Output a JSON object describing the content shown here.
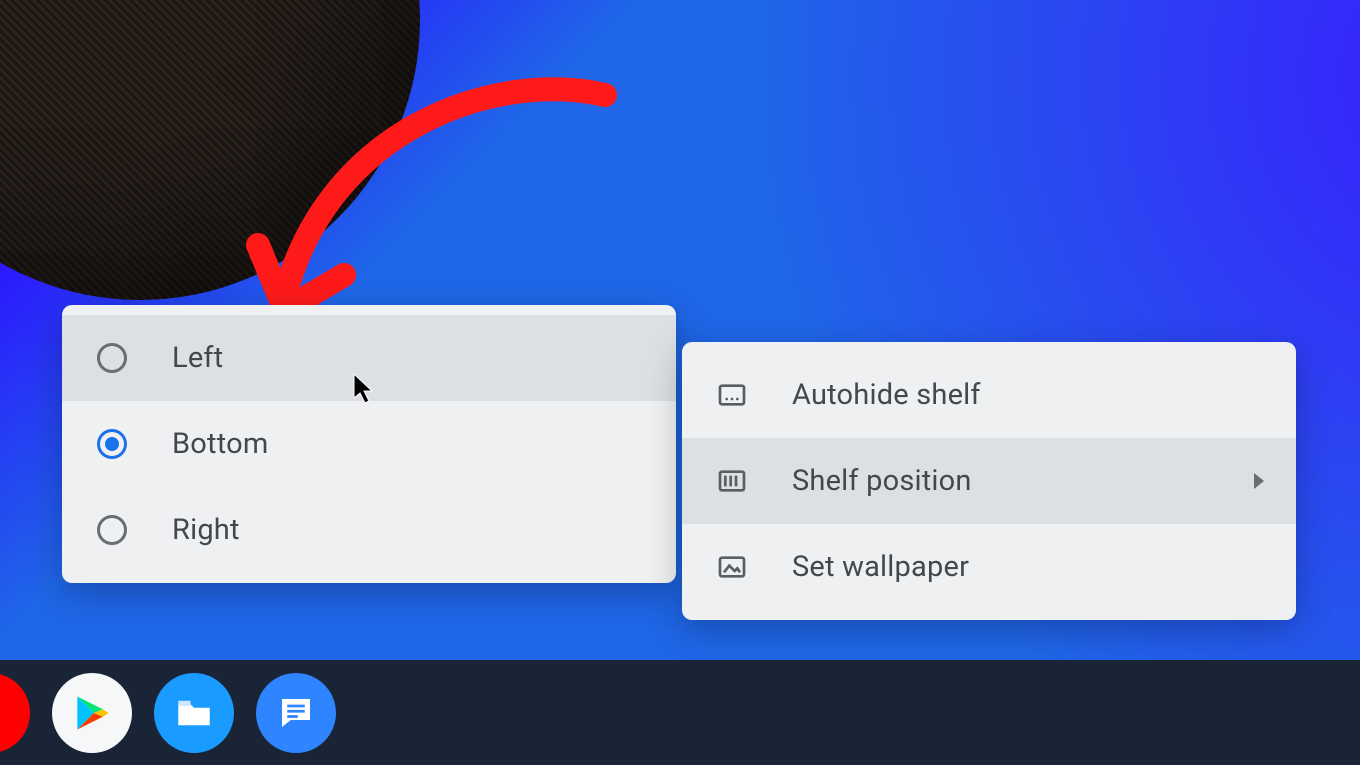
{
  "submenu": {
    "options": [
      {
        "label": "Left",
        "selected": false,
        "hovered": true
      },
      {
        "label": "Bottom",
        "selected": true,
        "hovered": false
      },
      {
        "label": "Right",
        "selected": false,
        "hovered": false
      }
    ]
  },
  "context_menu": {
    "items": [
      {
        "label": "Autohide shelf",
        "icon": "autohide-icon",
        "has_submenu": false,
        "hovered": false
      },
      {
        "label": "Shelf position",
        "icon": "position-icon",
        "has_submenu": true,
        "hovered": true
      },
      {
        "label": "Set wallpaper",
        "icon": "wallpaper-icon",
        "has_submenu": false,
        "hovered": false
      }
    ]
  },
  "shelf": {
    "apps": [
      {
        "name": "youtube-peek",
        "icon": "youtube-icon"
      },
      {
        "name": "play-store",
        "icon": "play-icon"
      },
      {
        "name": "files",
        "icon": "files-icon"
      },
      {
        "name": "messages",
        "icon": "messages-icon"
      }
    ]
  },
  "annotation": {
    "arrow_color": "#ff1a1a"
  }
}
